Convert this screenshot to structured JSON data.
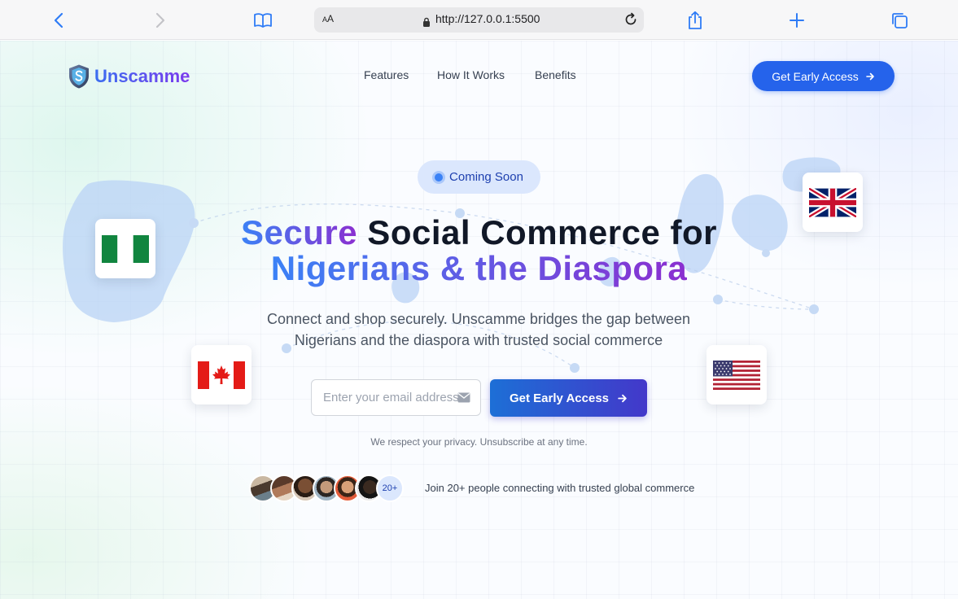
{
  "browser": {
    "url": "http://127.0.0.1:5500",
    "text_size_label_small": "A",
    "text_size_label_large": "A"
  },
  "nav": {
    "brand": "Unscamme",
    "links": [
      "Features",
      "How It Works",
      "Benefits"
    ],
    "cta_label": "Get Early Access"
  },
  "hero": {
    "badge": "Coming Soon",
    "headline_line1_accent": "Secure",
    "headline_line1_rest": " Social Commerce for",
    "headline_line2": "Nigerians & the Diaspora",
    "subtitle": "Connect and shop securely. Unscamme bridges the gap between Nigerians and the diaspora with trusted social commerce",
    "email_placeholder": "Enter your email address",
    "email_value": "",
    "submit_label": "Get Early Access",
    "privacy_note": "We respect your privacy. Unsubscribe at any time."
  },
  "social_proof": {
    "avatar_count_label": "20+",
    "text": "Join 20+ people connecting with trusted global commerce"
  },
  "flags": [
    "nigeria-flag",
    "uk-flag",
    "canada-flag",
    "usa-flag"
  ],
  "colors": {
    "primary": "#2563eb",
    "gradient_start": "#3b82f6",
    "gradient_end": "#8b2fd0",
    "badge_bg": "#dbe7fd"
  }
}
